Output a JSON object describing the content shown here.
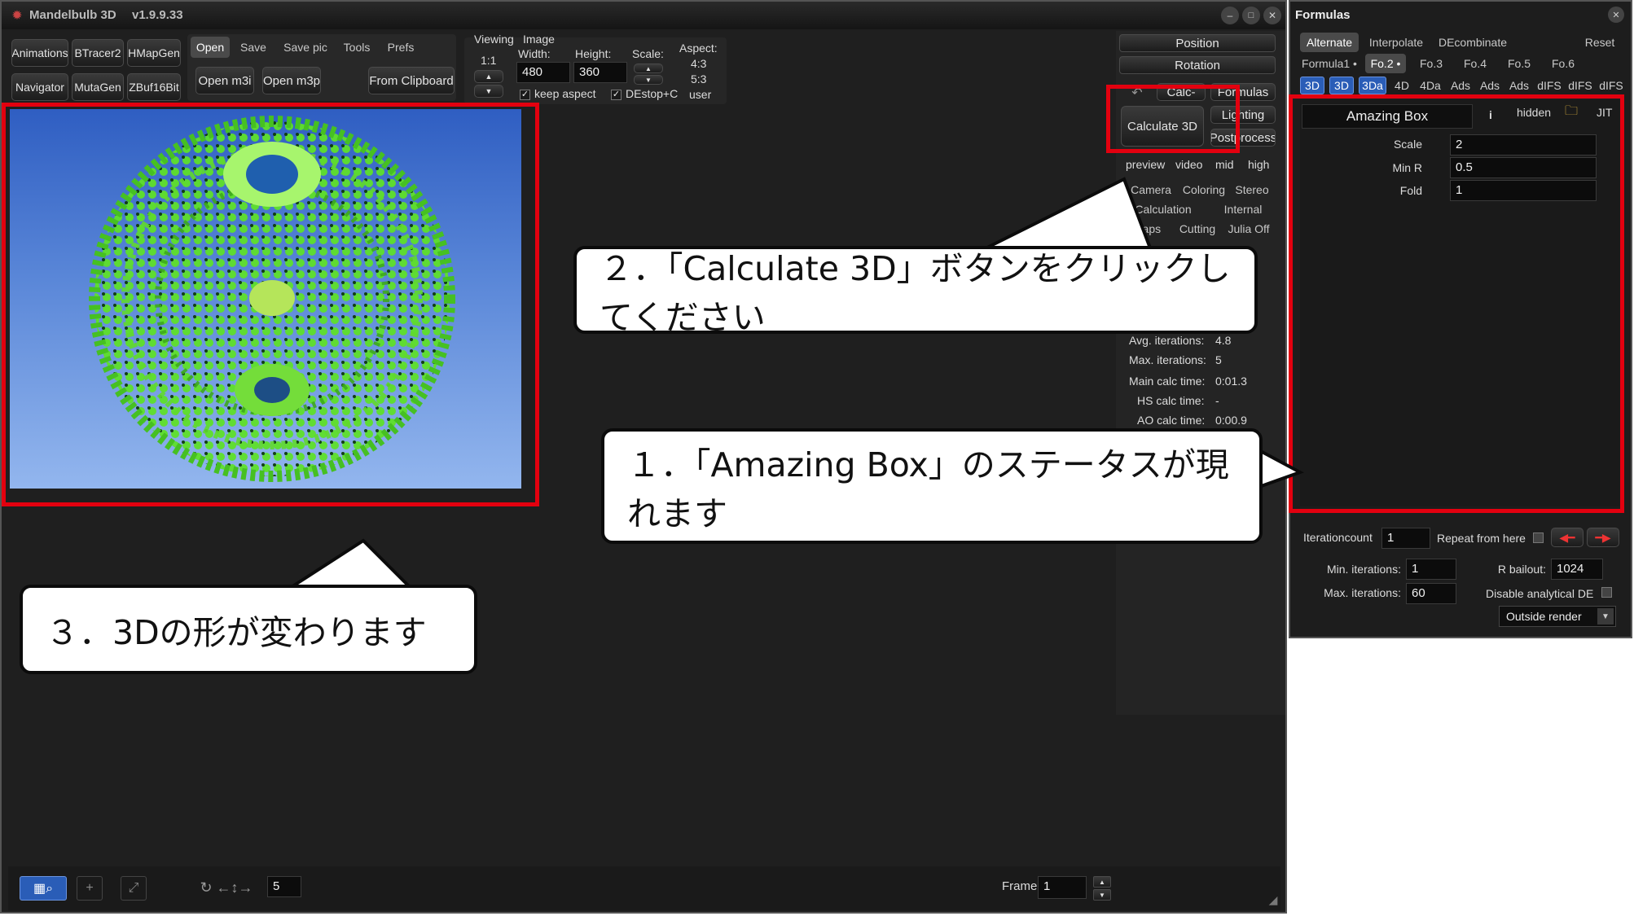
{
  "app": {
    "name": "Mandelbulb 3D",
    "version": "v1.9.9.33"
  },
  "toolbar": {
    "row1": [
      "Animations",
      "BTracer2",
      "HMapGen"
    ],
    "row2": [
      "Navigator",
      "MutaGen",
      "ZBuf16Bit"
    ],
    "menu_tabs": [
      "Open",
      "Save",
      "Save pic",
      "Tools",
      "Prefs"
    ],
    "open_m3i": "Open m3i",
    "open_m3p": "Open m3p",
    "from_clipboard": "From Clipboard"
  },
  "image_settings": {
    "viewing_label": "Viewing",
    "viewing_ratio": "1:1",
    "image_label": "Image",
    "width_label": "Width:",
    "width": "480",
    "height_label": "Height:",
    "height": "360",
    "scale_label": "Scale:",
    "aspect_label": "Aspect:",
    "aspect_options": [
      "4:3",
      "5:3",
      "user"
    ],
    "keep_aspect": "keep aspect",
    "destop": "DEstop+C"
  },
  "right_panel": {
    "position": "Position",
    "rotation": "Rotation",
    "calc": "Calc-",
    "formulas": "Formulas",
    "calculate_3d": "Calculate 3D",
    "lighting": "Lighting",
    "postprocess": "Postprocess",
    "quality": [
      "preview",
      "video",
      "mid",
      "high"
    ],
    "tabs_row1": [
      "Camera",
      "Coloring",
      "Stereo"
    ],
    "tabs_row2": [
      "Calculation",
      "Internal"
    ],
    "tabs_row3": [
      "Maps",
      "Cutting",
      "Julia Off"
    ],
    "stats": [
      {
        "label": "Avg. iterations:",
        "value": "4.8"
      },
      {
        "label": "Max. iterations:",
        "value": "5"
      },
      {
        "label": "Main calc time:",
        "value": "0:01.3"
      },
      {
        "label": "HS calc time:",
        "value": "-"
      },
      {
        "label": "AO calc time:",
        "value": "0:00.9"
      }
    ]
  },
  "bottom_bar": {
    "nav_value": "5",
    "frame_label": "Frame:",
    "frame_value": "1"
  },
  "formulas_window": {
    "title": "Formulas",
    "tabs": [
      "Alternate",
      "Interpolate",
      "DEcombinate"
    ],
    "reset": "Reset",
    "formula_slots": [
      "Formula1 •",
      "Fo.2 •",
      "Fo.3",
      "Fo.4",
      "Fo.5",
      "Fo.6"
    ],
    "toggles": [
      "3D",
      "3D",
      "3Da",
      "4D",
      "4Da",
      "Ads",
      "Ads",
      "Ads",
      "dIFS",
      "dIFS",
      "dIFS"
    ],
    "formula_name": "Amazing Box",
    "info": "i",
    "hidden": "hidden",
    "jit": "JIT",
    "params": [
      {
        "label": "Scale",
        "value": "2"
      },
      {
        "label": "Min R",
        "value": "0.5"
      },
      {
        "label": "Fold",
        "value": "1"
      }
    ],
    "iteration_count_label": "Iterationcount",
    "iteration_count": "1",
    "repeat_from_here": "Repeat from here",
    "min_iter_label": "Min. iterations:",
    "min_iter": "1",
    "max_iter_label": "Max. iterations:",
    "max_iter": "60",
    "rbailout_label": "R bailout:",
    "rbailout": "1024",
    "disable_de": "Disable analytical DE",
    "outside_render": "Outside render"
  },
  "annotations": {
    "step1": "１．「Amazing Box」のステータスが現れます",
    "step2": "２．「Calculate 3D」ボタンをクリックしてください",
    "step3": "３．3Dの形が変わります"
  },
  "colors": {
    "highlight": "#e3000f",
    "toggle_active": "#2a5db7",
    "fractal": "#5ee02a"
  }
}
